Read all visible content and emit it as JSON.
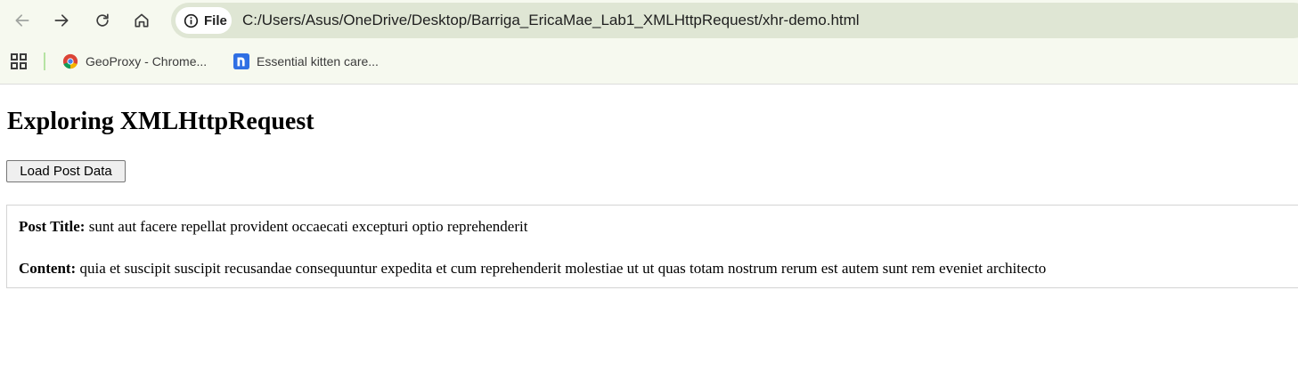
{
  "browser": {
    "site_chip_label": "File",
    "url": "C:/Users/Asus/OneDrive/Desktop/Barriga_EricaMae_Lab1_XMLHttpRequest/xhr-demo.html",
    "bookmarks": [
      {
        "label": "GeoProxy - Chrome...",
        "icon": "chrome-icon"
      },
      {
        "label": "Essential kitten care...",
        "icon": "notion-n-icon"
      }
    ]
  },
  "page": {
    "title": "Exploring XMLHttpRequest",
    "load_button_label": "Load Post Data",
    "post": {
      "title_label": "Post Title:",
      "title_value": "sunt aut facere repellat provident occaecati excepturi optio reprehenderit",
      "content_label": "Content:",
      "content_value": "quia et suscipit suscipit recusandae consequuntur expedita et cum reprehenderit molestiae ut ut quas totam nostrum rerum est autem sunt rem eveniet architecto"
    }
  },
  "colors": {
    "toolbar_bg": "#f6f9ef",
    "omnibox_bg": "#dfe6d4",
    "notion_blue": "#2f6fe4"
  }
}
